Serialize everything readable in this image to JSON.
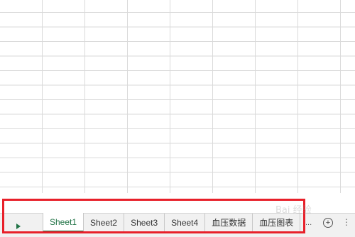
{
  "sheet_tabs": [
    {
      "label": "Sheet1",
      "active": true
    },
    {
      "label": "Sheet2",
      "active": false
    },
    {
      "label": "Sheet3",
      "active": false
    },
    {
      "label": "Sheet4",
      "active": false
    },
    {
      "label": "血压数据",
      "active": false
    },
    {
      "label": "血压图表",
      "active": false
    }
  ],
  "tab_overflow": "...",
  "add_sheet_symbol": "+",
  "options_symbol": "⋮",
  "watermark": "Bai 经验",
  "colors": {
    "active_tab": "#217346",
    "highlight_box": "#e8202a",
    "gridline": "#dadada",
    "tabbar_bg": "#f1f1f1"
  },
  "icons": {
    "nav": "triangle-right-icon",
    "add": "plus-circle-icon",
    "options": "vertical-dots-icon"
  }
}
